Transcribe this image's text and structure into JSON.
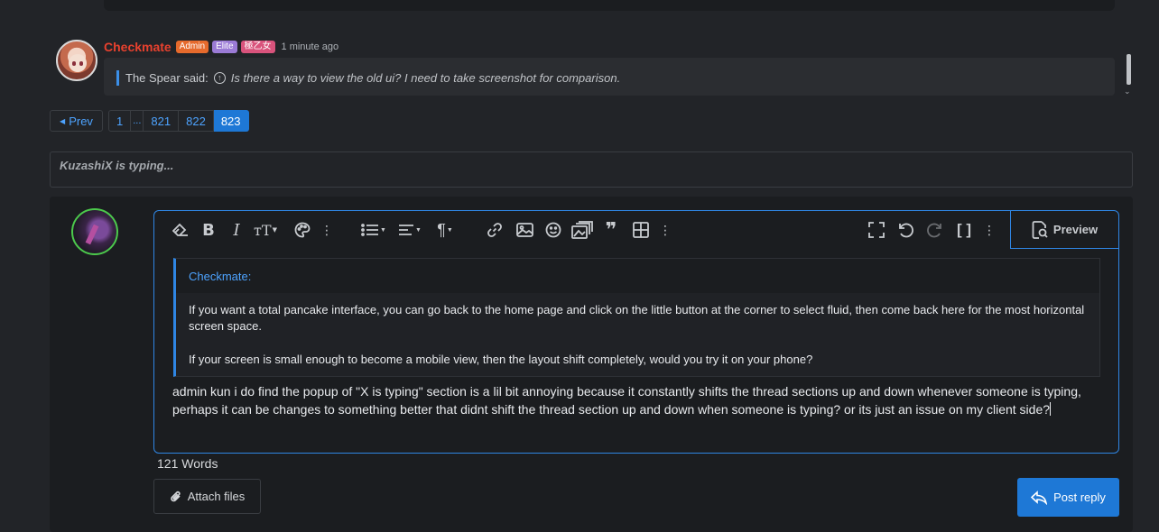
{
  "post": {
    "username": "Checkmate",
    "badges": [
      "Admin",
      "Elite",
      "極乙女"
    ],
    "time": "1 minute ago",
    "quote_author": "The Spear said:",
    "quote_text": "Is there a way to view the old ui? I need to take screenshot for comparison."
  },
  "pagination": {
    "prev_label": "Prev",
    "first": "1",
    "dots": "...",
    "pages": [
      "821",
      "822"
    ],
    "current": "823"
  },
  "typing_indicator": "KuzashiX is typing...",
  "editor": {
    "preview_label": "Preview",
    "quote": {
      "author": "Checkmate:",
      "paragraph1": "If you want a total pancake interface, you can go back to the home page and click on the little button at the corner to select fluid, then come back here for the most horizontal screen space.",
      "paragraph2": "If your screen is small enough to become a mobile view, then the layout shift completely, would you try it on your phone?"
    },
    "body": "admin kun i do find the popup of \"X is typing\" section is a lil bit annoying because it constantly shifts the thread sections up and down whenever someone is typing, perhaps it can be changes to something better that didnt shift the thread section up and down when someone is typing? or its just an issue on my client side?"
  },
  "word_count": "121 Words",
  "attach_label": "Attach files",
  "post_reply_label": "Post reply",
  "colors": {
    "accent": "#1e78d6",
    "username": "#e8412e",
    "badge_admin": "#e66a2c",
    "badge_elite": "#9b7bd6",
    "badge_title": "#d9537c"
  }
}
